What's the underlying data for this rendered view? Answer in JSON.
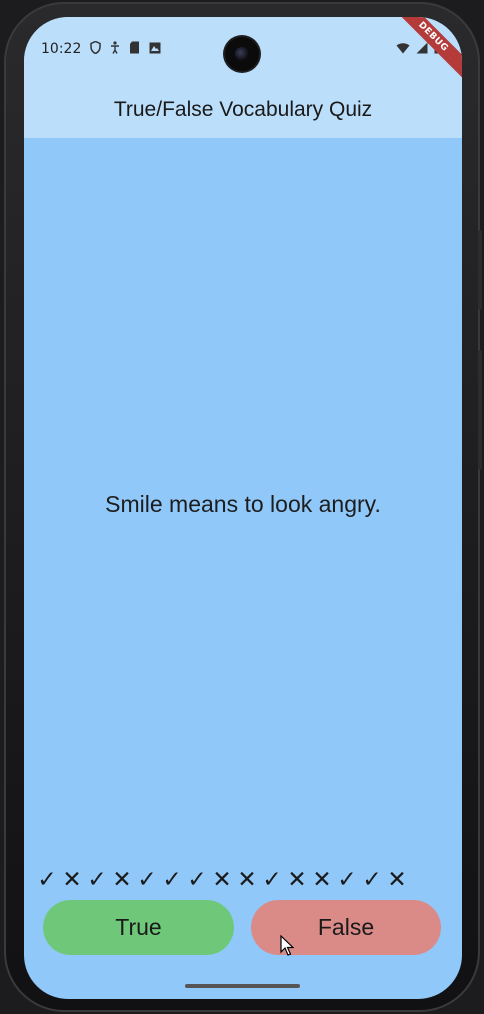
{
  "status_bar": {
    "time": "10:22",
    "debug_label": "DEBUG"
  },
  "app_bar": {
    "title": "True/False Vocabulary Quiz"
  },
  "quiz": {
    "question": "Smile means to look angry.",
    "score_marks": [
      "✓",
      "✕",
      "✓",
      "✕",
      "✓",
      "✓",
      "✓",
      "✕",
      "✕",
      "✓",
      "✕",
      "✕",
      "✓",
      "✓",
      "✕"
    ]
  },
  "buttons": {
    "true_label": "True",
    "false_label": "False"
  },
  "colors": {
    "app_bar_bg": "#bbdefb",
    "body_bg": "#90c8fa",
    "true_button": "#6fc87a",
    "false_button": "#db8b87"
  }
}
